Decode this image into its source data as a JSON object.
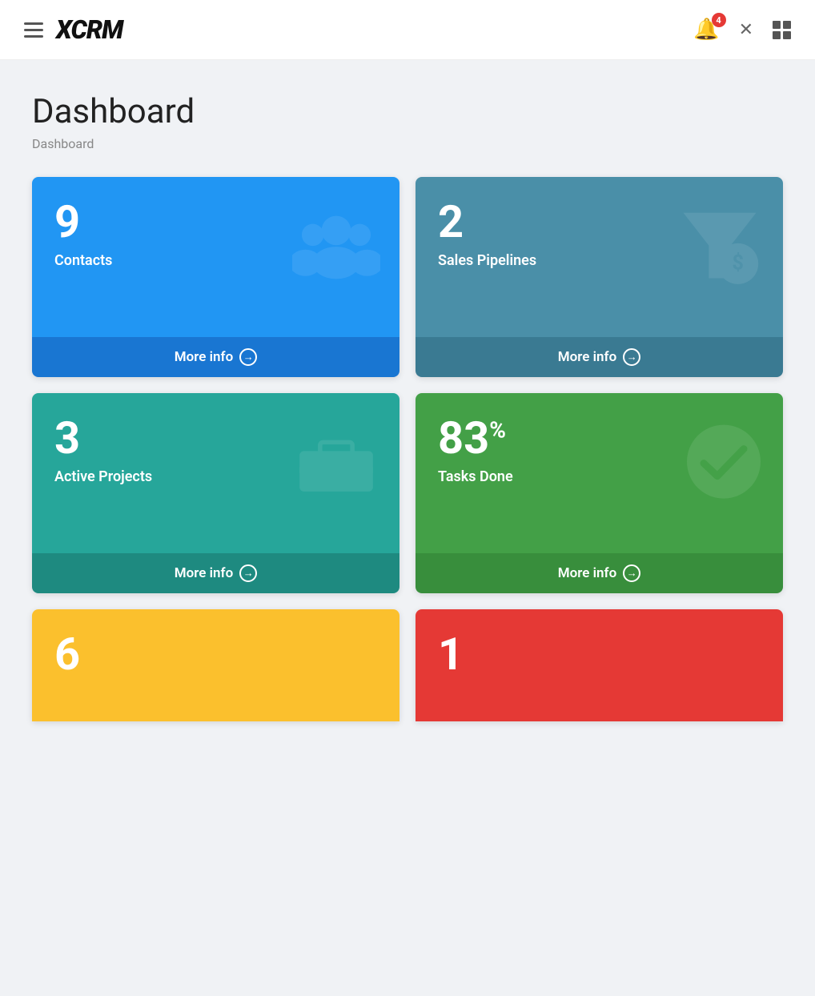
{
  "header": {
    "logo": "XCRM",
    "logo_x": "X",
    "notification_count": "4",
    "hamburger_label": "menu"
  },
  "page": {
    "title": "Dashboard",
    "breadcrumb": "Dashboard"
  },
  "cards": [
    {
      "id": "contacts",
      "number": "9",
      "label": "Contacts",
      "more_info": "More info",
      "color_class": "card-blue",
      "icon_type": "contacts"
    },
    {
      "id": "sales-pipelines",
      "number": "2",
      "label": "Sales Pipelines",
      "more_info": "More info",
      "color_class": "card-teal",
      "icon_type": "funnel"
    },
    {
      "id": "active-projects",
      "number": "3",
      "label": "Active Projects",
      "more_info": "More info",
      "color_class": "card-cyan",
      "icon_type": "briefcase"
    },
    {
      "id": "tasks-done",
      "number": "83",
      "number_suffix": "%",
      "label": "Tasks Done",
      "more_info": "More info",
      "color_class": "card-green",
      "icon_type": "checkmark"
    }
  ],
  "partial_cards": [
    {
      "id": "partial-left",
      "number": "6",
      "color_class": "card-yellow"
    },
    {
      "id": "partial-right",
      "number": "1",
      "color_class": "card-red"
    }
  ]
}
